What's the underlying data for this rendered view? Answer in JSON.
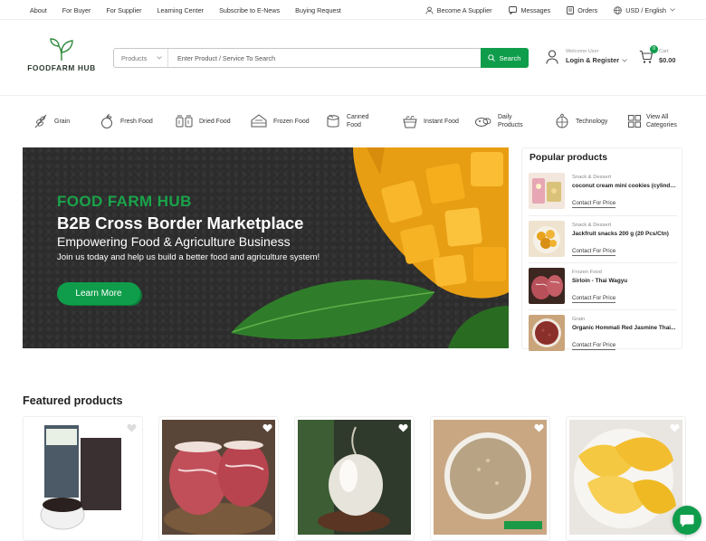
{
  "topbar": {
    "nav": [
      "About",
      "For Buyer",
      "For Supplier",
      "Learning Center",
      "Subscribe to E-News",
      "Buying Request"
    ],
    "become_supplier": "Become A Supplier",
    "messages": "Messages",
    "orders": "Orders",
    "currency_language": "USD / English"
  },
  "header": {
    "logo_text": "FOODFARM HUB",
    "search_category": "Products",
    "search_placeholder": "Enter Product / Service To Search",
    "search_button": "Search",
    "welcome": "Welcome User",
    "login": "Login & Register",
    "cart_label": "Cart",
    "cart_amount": "$0.00",
    "cart_count": "0"
  },
  "categories": [
    {
      "label": "Grain",
      "icon": "grain-icon"
    },
    {
      "label": "Fresh Food",
      "icon": "fresh-food-icon"
    },
    {
      "label": "Dried Food",
      "icon": "dried-food-icon"
    },
    {
      "label": "Frozen Food",
      "icon": "frozen-food-icon"
    },
    {
      "label": "Canned Food",
      "icon": "canned-food-icon"
    },
    {
      "label": "Instant Food",
      "icon": "instant-food-icon"
    },
    {
      "label": "Daily Products",
      "icon": "daily-products-icon"
    },
    {
      "label": "Technology",
      "icon": "technology-icon"
    },
    {
      "label": "View All Categories",
      "icon": "grid-icon"
    }
  ],
  "hero": {
    "brand": "FOOD FARM HUB",
    "title": "B2B Cross Border Marketplace",
    "subtitle": "Empowering Food & Agriculture Business",
    "text": "Join us today and help us build a better food and agriculture system!",
    "button": "Learn More"
  },
  "popular": {
    "title": "Popular products",
    "items": [
      {
        "category": "Snack & Dessert",
        "name": "coconut cream mini cookies (cylinder...",
        "price": "Contact For Price"
      },
      {
        "category": "Snack & Dessert",
        "name": "Jackfruit snacks 200 g (20 Pcs/Ctn)",
        "price": "Contact For Price"
      },
      {
        "category": "Frozen Food",
        "name": "Sirloin - Thai Wagyu",
        "price": "Contact For Price"
      },
      {
        "category": "Grain",
        "name": "Organic Hommali Red Jasmine Thai...",
        "price": "Contact For Price"
      }
    ]
  },
  "featured": {
    "title": "Featured products"
  },
  "colors": {
    "accent": "#0f9d4b",
    "hero_bg": "#2c2c2c"
  }
}
